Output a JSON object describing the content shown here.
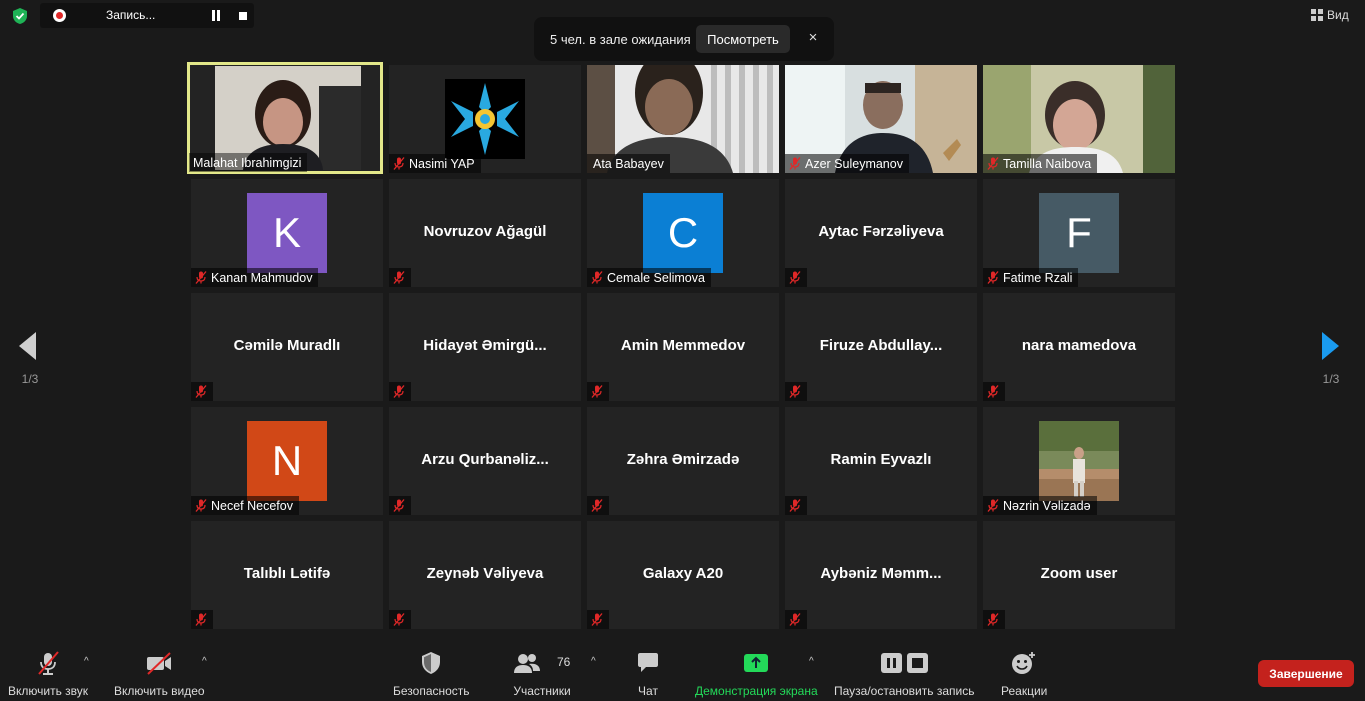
{
  "topbar": {
    "recording_label": "Запись...",
    "waiting_text": "5 чел. в зале ожидания",
    "waiting_button": "Посмотреть",
    "waiting_close": "×",
    "view_label": "Вид"
  },
  "pager": {
    "left": "1/3",
    "right": "1/3"
  },
  "tiles": [
    {
      "name": "Malahat Ibrahimgizi",
      "center": "",
      "avatar": "",
      "avatar_color": ""
    },
    {
      "name": "Nasimi YAP",
      "center": "",
      "avatar": "",
      "avatar_color": ""
    },
    {
      "name": "Ata Babayev",
      "center": "",
      "avatar": "",
      "avatar_color": ""
    },
    {
      "name": "Azer Suleymanov",
      "center": "",
      "avatar": "",
      "avatar_color": ""
    },
    {
      "name": "Tamilla Naibova",
      "center": "",
      "avatar": "",
      "avatar_color": ""
    },
    {
      "name": "Kanan Mahmudov",
      "center": "",
      "avatar": "K",
      "avatar_color": "#7e57c2"
    },
    {
      "name": "",
      "center": "Novruzov Ağagül",
      "avatar": "",
      "avatar_color": ""
    },
    {
      "name": "Cemale Selimova",
      "center": "",
      "avatar": "C",
      "avatar_color": "#0b7fd4"
    },
    {
      "name": "",
      "center": "Aytac Fərzəliyeva",
      "avatar": "",
      "avatar_color": ""
    },
    {
      "name": "Fatime Rzali",
      "center": "",
      "avatar": "F",
      "avatar_color": "#465a65"
    },
    {
      "name": "",
      "center": "Cəmilə Muradlı",
      "avatar": "",
      "avatar_color": ""
    },
    {
      "name": "",
      "center": "Hidayət  Əmirgü...",
      "avatar": "",
      "avatar_color": ""
    },
    {
      "name": "",
      "center": "Amin Memmedov",
      "avatar": "",
      "avatar_color": ""
    },
    {
      "name": "",
      "center": "Firuze  Abdullay...",
      "avatar": "",
      "avatar_color": ""
    },
    {
      "name": "",
      "center": "nara mamedova",
      "avatar": "",
      "avatar_color": ""
    },
    {
      "name": "Necef Necefov",
      "center": "",
      "avatar": "N",
      "avatar_color": "#d14817"
    },
    {
      "name": "",
      "center": "Arzu  Qurbanəliz...",
      "avatar": "",
      "avatar_color": ""
    },
    {
      "name": "",
      "center": "Zəhra Əmirzadə",
      "avatar": "",
      "avatar_color": ""
    },
    {
      "name": "",
      "center": "Ramin Eyvazlı",
      "avatar": "",
      "avatar_color": ""
    },
    {
      "name": "Nəzrin Vəlizadə",
      "center": "",
      "avatar": "",
      "avatar_color": ""
    },
    {
      "name": "",
      "center": "Talıblı Lətifə",
      "avatar": "",
      "avatar_color": ""
    },
    {
      "name": "",
      "center": "Zeynəb Vəliyeva",
      "avatar": "",
      "avatar_color": ""
    },
    {
      "name": "",
      "center": "Galaxy A20",
      "avatar": "",
      "avatar_color": ""
    },
    {
      "name": "",
      "center": "Aybəniz  Məmm...",
      "avatar": "",
      "avatar_color": ""
    },
    {
      "name": "",
      "center": "Zoom user",
      "avatar": "",
      "avatar_color": ""
    }
  ],
  "toolbar": {
    "audio": "Включить звук",
    "video": "Включить видео",
    "security": "Безопасность",
    "participants": "Участники",
    "participants_count": "76",
    "chat": "Чат",
    "share": "Демонстрация экрана",
    "record": "Пауза/остановить запись",
    "reactions": "Реакции",
    "end": "Завершение"
  },
  "colors": {
    "active_speaker": "#e3e88a",
    "share_green": "#23d959",
    "end_red": "#c4221d",
    "nav_arrow": "#1a9bf0",
    "mute_red": "#e02828"
  }
}
